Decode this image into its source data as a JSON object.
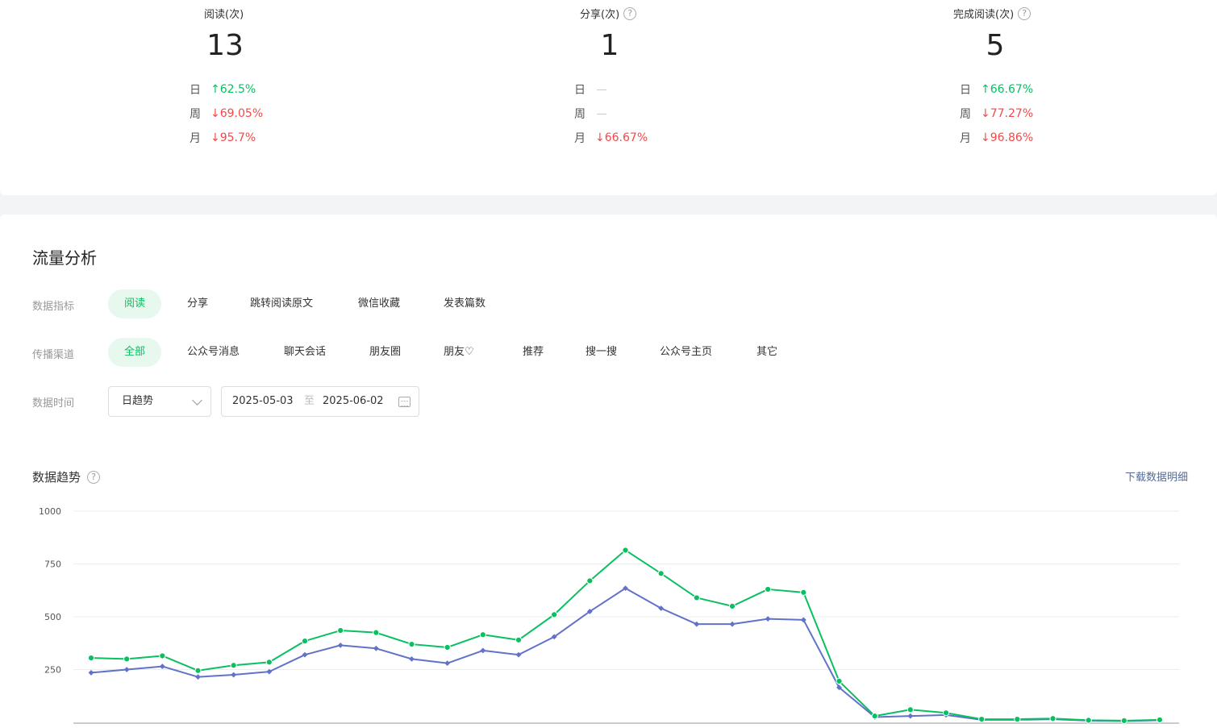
{
  "stats": [
    {
      "title": "阅读(次)",
      "value": "13",
      "help": false,
      "rows": [
        {
          "label": "日",
          "dir": "up",
          "arrow": "↑",
          "value": "62.5%"
        },
        {
          "label": "周",
          "dir": "down",
          "arrow": "↓",
          "value": "69.05%"
        },
        {
          "label": "月",
          "dir": "down",
          "arrow": "↓",
          "value": "95.7%"
        }
      ]
    },
    {
      "title": "分享(次)",
      "value": "1",
      "help": true,
      "rows": [
        {
          "label": "日",
          "dir": "none",
          "arrow": "",
          "value": ""
        },
        {
          "label": "周",
          "dir": "none",
          "arrow": "",
          "value": ""
        },
        {
          "label": "月",
          "dir": "down",
          "arrow": "↓",
          "value": "66.67%"
        }
      ]
    },
    {
      "title": "完成阅读(次)",
      "value": "5",
      "help": true,
      "rows": [
        {
          "label": "日",
          "dir": "up",
          "arrow": "↑",
          "value": "66.67%"
        },
        {
          "label": "周",
          "dir": "down",
          "arrow": "↓",
          "value": "77.27%"
        },
        {
          "label": "月",
          "dir": "down",
          "arrow": "↓",
          "value": "96.86%"
        }
      ]
    }
  ],
  "traffic": {
    "title": "流量分析",
    "metric_label": "数据指标",
    "metrics": [
      "阅读",
      "分享",
      "跳转阅读原文",
      "微信收藏",
      "发表篇数"
    ],
    "metric_active": 0,
    "channel_label": "传播渠道",
    "channels": [
      "全部",
      "公众号消息",
      "聊天会话",
      "朋友圈",
      "朋友♡",
      "推荐",
      "搜一搜",
      "公众号主页",
      "其它"
    ],
    "channel_active": 0,
    "time_label": "数据时间",
    "granularity": "日趋势",
    "date_start": "2025-05-03",
    "date_sep": "至",
    "date_end": "2025-06-02"
  },
  "trend": {
    "title": "数据趋势",
    "download": "下载数据明细"
  },
  "colors": {
    "green": "#07c160",
    "blue": "#6271c9",
    "red": "#f04a4a"
  },
  "chart_data": {
    "type": "line",
    "ylim": [
      0,
      1000
    ],
    "yticks": [
      "1000",
      "750",
      "500",
      "250"
    ],
    "grid": true,
    "series": [
      {
        "color": "#07c160",
        "marker": "circle",
        "values": [
          305,
          300,
          315,
          245,
          270,
          285,
          385,
          435,
          425,
          370,
          355,
          415,
          390,
          510,
          670,
          815,
          705,
          590,
          550,
          630,
          615,
          195,
          30,
          60,
          45,
          15,
          15,
          18,
          10,
          8,
          12
        ]
      },
      {
        "color": "#6271c9",
        "marker": "diamond",
        "values": [
          235,
          250,
          265,
          215,
          225,
          240,
          320,
          365,
          350,
          300,
          280,
          340,
          320,
          405,
          525,
          635,
          540,
          465,
          465,
          490,
          485,
          165,
          25,
          30,
          35,
          12,
          12,
          15,
          8,
          6,
          10
        ]
      }
    ]
  }
}
